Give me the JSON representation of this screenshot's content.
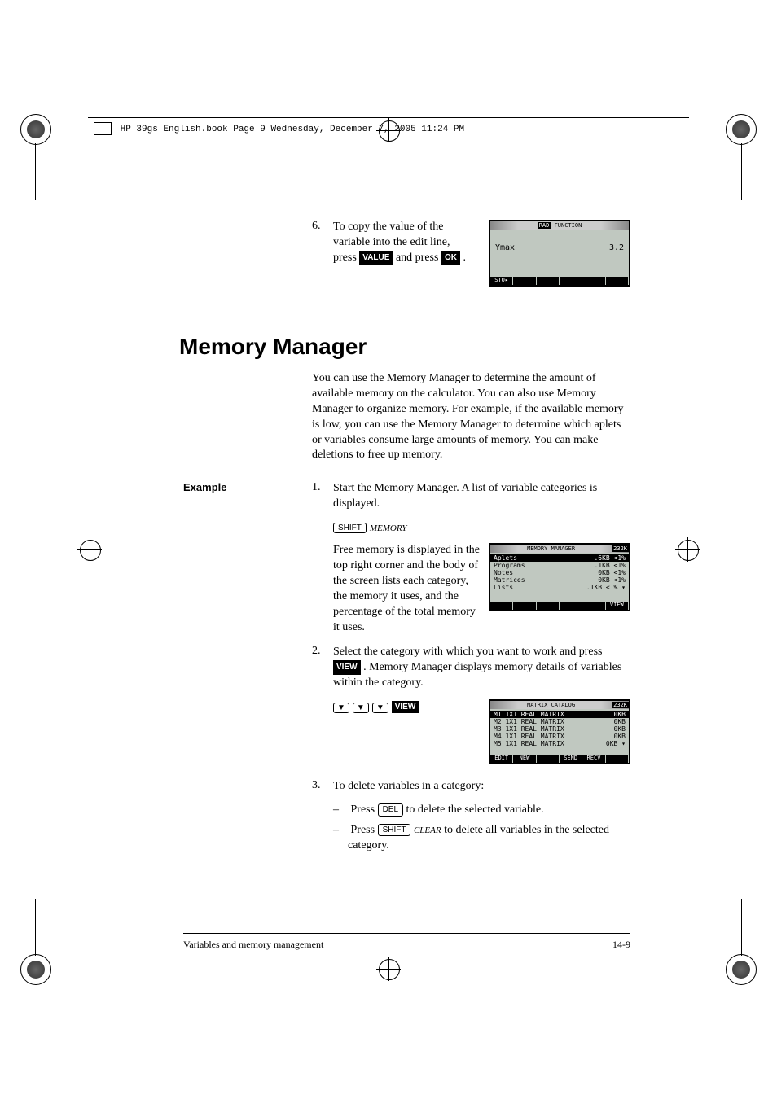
{
  "header": {
    "file_info": "HP 39gs English.book  Page 9  Wednesday, December 7, 2005  11:24 PM"
  },
  "step6": {
    "num": "6.",
    "text_before": "To copy the value of the variable into the edit line, press ",
    "key1": "VALUE",
    "text_mid": " and press ",
    "key2": "OK",
    "text_after": " ."
  },
  "screen1": {
    "title_left": "RAD",
    "title_center": "FUNCTION",
    "line1_left": "Ymax",
    "line1_right": "3.2",
    "footer_tab": "STO▸"
  },
  "section": {
    "title": "Memory Manager",
    "intro": "You can use the Memory Manager to determine the amount of available memory on the calculator. You can also use Memory Manager to organize memory. For example, if the available memory is low, you can use the Memory Manager to determine which aplets or variables consume large amounts of memory. You can make deletions to free up memory."
  },
  "example": {
    "label": "Example",
    "step1": {
      "num": "1.",
      "text": "Start the Memory Manager. A list of variable categories is displayed.",
      "key_shift": "SHIFT",
      "key_memory": "MEMORY",
      "note": "Free memory is displayed in the top right corner and the body of the screen lists each category, the memory it uses, and the percentage of the total memory it uses."
    },
    "step2": {
      "num": "2.",
      "text_before": "Select the category with which you want to work and press ",
      "key_view": "VIEW",
      "text_after": " . Memory Manager displays memory details of variables within the category.",
      "keys_arrows": "▼",
      "key_view2": "VIEW"
    },
    "step3": {
      "num": "3.",
      "text": "To delete variables in a category:",
      "sub1_before": "Press ",
      "sub1_key": "DEL",
      "sub1_after": " to delete the selected variable.",
      "sub2_before": "Press ",
      "sub2_key_shift": "SHIFT",
      "sub2_key_clear": "CLEAR",
      "sub2_after": " to delete all variables in the selected category."
    }
  },
  "screen2": {
    "title": "MEMORY MANAGER",
    "free": "232K",
    "rows": [
      {
        "name": "Aplets",
        "size": ".6KB",
        "pct": "<1%"
      },
      {
        "name": "Programs",
        "size": ".1KB",
        "pct": "<1%"
      },
      {
        "name": "Notes",
        "size": "0KB",
        "pct": "<1%"
      },
      {
        "name": "Matrices",
        "size": "0KB",
        "pct": "<1%"
      },
      {
        "name": "Lists",
        "size": ".1KB",
        "pct": "<1%"
      }
    ],
    "footer_tab": "VIEW"
  },
  "screen3": {
    "title": "MATRIX CATALOG",
    "free": "232K",
    "rows": [
      {
        "name": "M1 1X1 REAL MATRIX",
        "size": "0KB"
      },
      {
        "name": "M2 1X1 REAL MATRIX",
        "size": "0KB"
      },
      {
        "name": "M3 1X1 REAL MATRIX",
        "size": "0KB"
      },
      {
        "name": "M4 1X1 REAL MATRIX",
        "size": "0KB"
      },
      {
        "name": "M5 1X1 REAL MATRIX",
        "size": "0KB"
      }
    ],
    "footer": [
      "EDIT",
      "NEW",
      "",
      "SEND",
      "RECV",
      ""
    ]
  },
  "footer": {
    "left": "Variables and memory management",
    "right": "14-9"
  }
}
